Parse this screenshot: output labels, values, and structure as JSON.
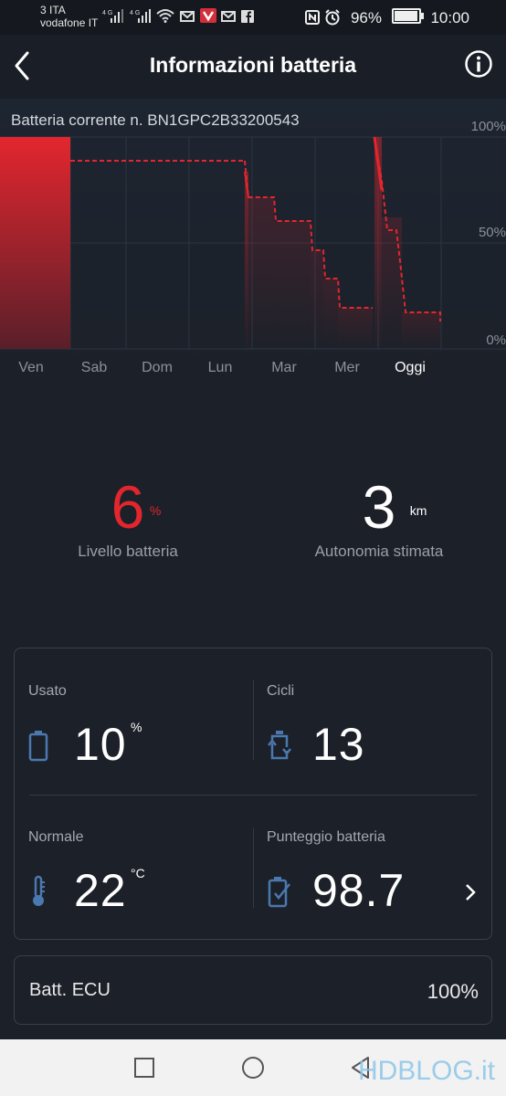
{
  "status_bar": {
    "carrier_1": "3 ITA",
    "carrier_2": "vodafone IT",
    "net_1": "4G",
    "net_2": "4G",
    "battery_pct": "96%",
    "time": "10:00"
  },
  "header": {
    "title": "Informazioni batteria"
  },
  "chart": {
    "serial_label": "Batteria corrente n. BN1GPC2B33200543",
    "y_ticks": [
      "100%",
      "50%",
      "0%"
    ],
    "x_ticks": [
      "Ven",
      "Sab",
      "Dom",
      "Lun",
      "Mar",
      "Mer",
      "Oggi"
    ]
  },
  "chart_data": {
    "type": "area",
    "categories": [
      "Ven",
      "Sab",
      "Dom",
      "Lun",
      "Mar",
      "Mer",
      "Oggi"
    ],
    "ylim": [
      0,
      100
    ],
    "series": [
      {
        "values_by_day": [
          {
            "day": "Ven",
            "level": 100
          },
          {
            "day": "Sab",
            "level": 88
          },
          {
            "day": "Dom",
            "level": 88
          },
          {
            "day": "Lun",
            "level": 88
          },
          {
            "day": "Mar",
            "level": 47
          },
          {
            "day": "Mer",
            "level": 19
          },
          {
            "day": "Oggi",
            "level": 14
          }
        ]
      }
    ],
    "accent_color": "#e3262e"
  },
  "summary": {
    "battery_level": {
      "value": "6",
      "unit": "%",
      "label": "Livello batteria"
    },
    "range": {
      "value": "3",
      "unit": "km",
      "label": "Autonomia stimata"
    }
  },
  "details": {
    "used": {
      "label": "Usato",
      "value": "10",
      "unit": "%",
      "icon": "battery-icon"
    },
    "cycles": {
      "label": "Cicli",
      "value": "13",
      "icon": "cycle-icon"
    },
    "temperature": {
      "label": "Normale",
      "value": "22",
      "unit": "°C",
      "icon": "thermometer-icon"
    },
    "score": {
      "label": "Punteggio batteria",
      "value": "98.7",
      "icon": "battery-check-icon"
    }
  },
  "ecu": {
    "label": "Batt. ECU",
    "value": "100%"
  },
  "watermark": "HDBLOG.it"
}
